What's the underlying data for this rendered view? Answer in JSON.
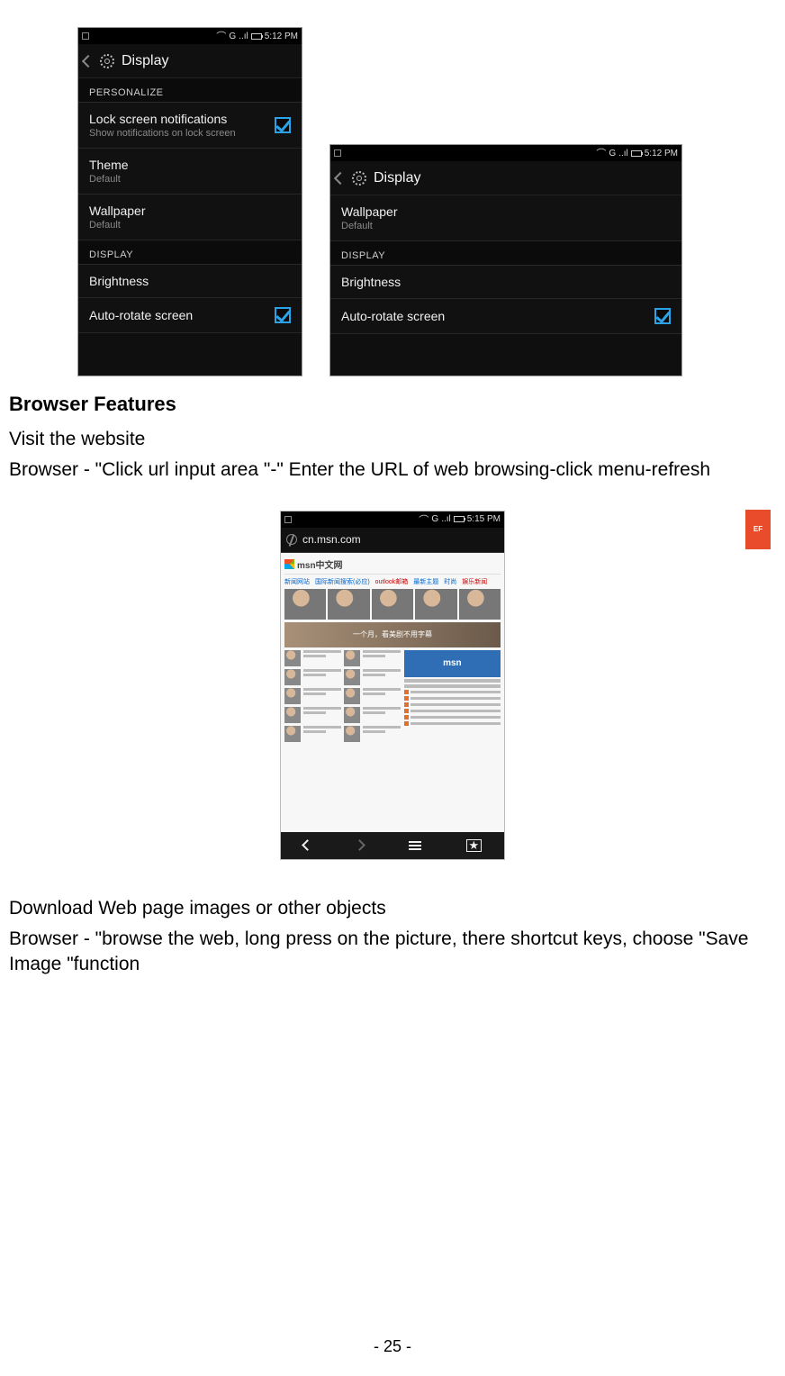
{
  "statusbar": {
    "signal": "G",
    "time1": "5:12 PM",
    "time2": "5:12 PM",
    "time3": "5:15 PM"
  },
  "settings1": {
    "title": "Display",
    "section_personalize": "PERSONALIZE",
    "lock_title": "Lock screen notifications",
    "lock_sub": "Show notifications on lock screen",
    "theme_title": "Theme",
    "theme_sub": "Default",
    "wallpaper_title": "Wallpaper",
    "wallpaper_sub": "Default",
    "section_display": "DISPLAY",
    "brightness": "Brightness",
    "autorotate": "Auto-rotate screen"
  },
  "settings2": {
    "title": "Display",
    "wallpaper_title": "Wallpaper",
    "wallpaper_sub": "Default",
    "section_display": "DISPLAY",
    "brightness": "Brightness",
    "autorotate": "Auto-rotate screen"
  },
  "doc": {
    "heading1": "Browser Features",
    "p1": "Visit the website",
    "p2": "Browser - \"Click url input area \"-\" Enter the URL of web browsing-click menu-refresh",
    "p3": "Download Web page images or other objects",
    "p4": "Browser - \"browse the web, long press on the picture, there shortcut keys, choose \"Save Image \"function",
    "pagenum": "- 25 -"
  },
  "browser": {
    "url": "cn.msn.com",
    "logo_text": "msn中文网",
    "banner_text": "一个月，看美剧不用字幕",
    "ef": "EF",
    "msn_block": "msn",
    "nav1": "新闻网站",
    "nav2": "国际新闻搜索(必应)",
    "nav3": "outlook邮箱",
    "nav4": "最新主题",
    "nav5": "时尚",
    "nav6": "娱乐新闻"
  }
}
